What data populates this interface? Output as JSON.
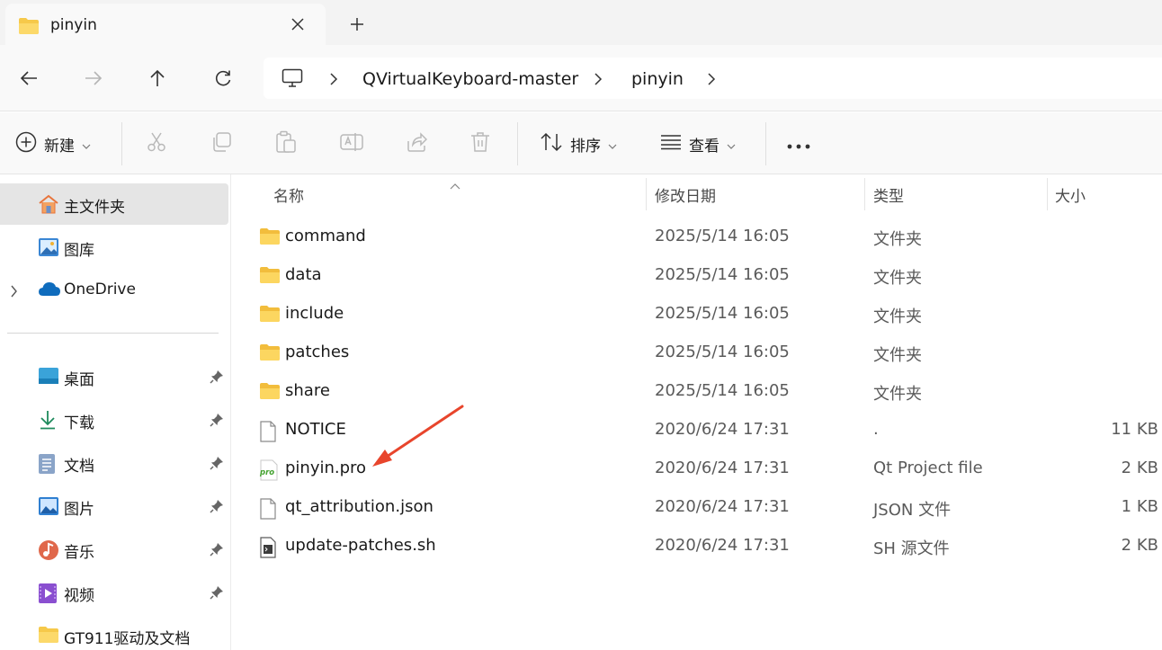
{
  "tab": {
    "title": "pinyin",
    "close_icon": "close-icon",
    "new_tab_icon": "plus-icon"
  },
  "nav": {
    "back_icon": "arrow-left-icon",
    "forward_icon": "arrow-right-icon",
    "up_icon": "arrow-up-icon",
    "refresh_icon": "refresh-icon",
    "breadcrumb": [
      "QVirtualKeyboard-master",
      "pinyin"
    ]
  },
  "commandbar": {
    "new_label": "新建",
    "sort_label": "排序",
    "view_label": "查看",
    "more_icon": "more-horizontal-icon"
  },
  "sidebar": {
    "top_items": [
      {
        "label": "主文件夹",
        "icon": "home-icon",
        "selected": true
      },
      {
        "label": "图库",
        "icon": "gallery-icon"
      },
      {
        "label": "OneDrive",
        "icon": "cloud-icon"
      }
    ],
    "pinned_items": [
      {
        "label": "桌面",
        "icon": "desktop-icon"
      },
      {
        "label": "下载",
        "icon": "download-icon"
      },
      {
        "label": "文档",
        "icon": "document-icon"
      },
      {
        "label": "图片",
        "icon": "pictures-icon"
      },
      {
        "label": "音乐",
        "icon": "music-icon"
      },
      {
        "label": "视频",
        "icon": "video-icon"
      },
      {
        "label": "GT911驱动及文档",
        "icon": "folder-icon"
      }
    ]
  },
  "columns": {
    "name": "名称",
    "modified": "修改日期",
    "type": "类型",
    "size": "大小"
  },
  "files": [
    {
      "name": "command",
      "date": "2025/5/14 16:05",
      "type": "文件夹",
      "size": "",
      "kind": "folder"
    },
    {
      "name": "data",
      "date": "2025/5/14 16:05",
      "type": "文件夹",
      "size": "",
      "kind": "folder"
    },
    {
      "name": "include",
      "date": "2025/5/14 16:05",
      "type": "文件夹",
      "size": "",
      "kind": "folder"
    },
    {
      "name": "patches",
      "date": "2025/5/14 16:05",
      "type": "文件夹",
      "size": "",
      "kind": "folder"
    },
    {
      "name": "share",
      "date": "2025/5/14 16:05",
      "type": "文件夹",
      "size": "",
      "kind": "folder"
    },
    {
      "name": "NOTICE",
      "date": "2020/6/24 17:31",
      "type": ".",
      "size": "11 KB",
      "kind": "file"
    },
    {
      "name": "pinyin.pro",
      "date": "2020/6/24 17:31",
      "type": "Qt Project file",
      "size": "2 KB",
      "kind": "pro"
    },
    {
      "name": "qt_attribution.json",
      "date": "2020/6/24 17:31",
      "type": "JSON 文件",
      "size": "1 KB",
      "kind": "file"
    },
    {
      "name": "update-patches.sh",
      "date": "2020/6/24 17:31",
      "type": "SH 源文件",
      "size": "2 KB",
      "kind": "script"
    }
  ],
  "colors": {
    "annotation_arrow": "#e8452c",
    "folder": "#f6c94a",
    "selected_bg": "#e5e5e5"
  }
}
